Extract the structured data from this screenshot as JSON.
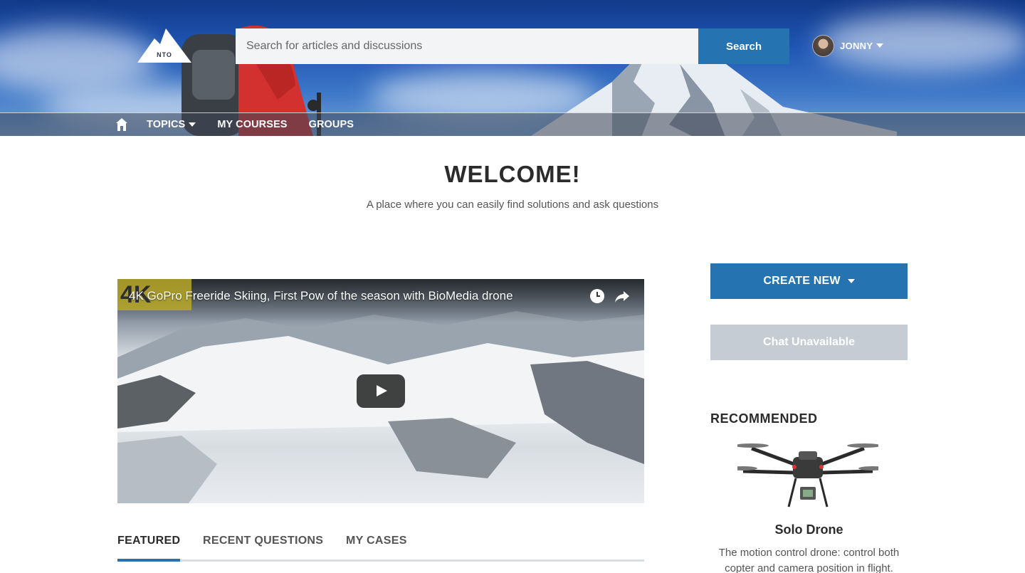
{
  "brand": {
    "logo_text": "NTO"
  },
  "search": {
    "placeholder": "Search for articles and discussions",
    "button_label": "Search"
  },
  "user": {
    "name": "JONNY"
  },
  "nav": {
    "items": [
      {
        "label": "TOPICS",
        "has_dropdown": true
      },
      {
        "label": "MY COURSES"
      },
      {
        "label": "GROUPS"
      }
    ]
  },
  "welcome": {
    "title": "WELCOME!",
    "subtitle": "A place where you can easily find solutions and ask questions"
  },
  "video": {
    "title": "4K GoPro Freeride Skiing, First Pow of the season with BioMedia drone",
    "badge": "4K",
    "icons": [
      "clock-icon",
      "share-icon",
      "play-icon"
    ]
  },
  "tabs": [
    {
      "label": "FEATURED",
      "active": true
    },
    {
      "label": "RECENT QUESTIONS",
      "active": false
    },
    {
      "label": "MY CASES",
      "active": false
    }
  ],
  "sidebar": {
    "create_new_label": "CREATE NEW",
    "chat_label": "Chat Unavailable",
    "recommended_heading": "RECOMMENDED",
    "product": {
      "name": "Solo Drone",
      "description": "The motion control drone: control both copter and camera position in flight."
    }
  },
  "colors": {
    "accent": "#2573b0",
    "disabled": "#c6ccd3",
    "heading": "#2b2b2b",
    "tab_border": "#d8dde3"
  }
}
